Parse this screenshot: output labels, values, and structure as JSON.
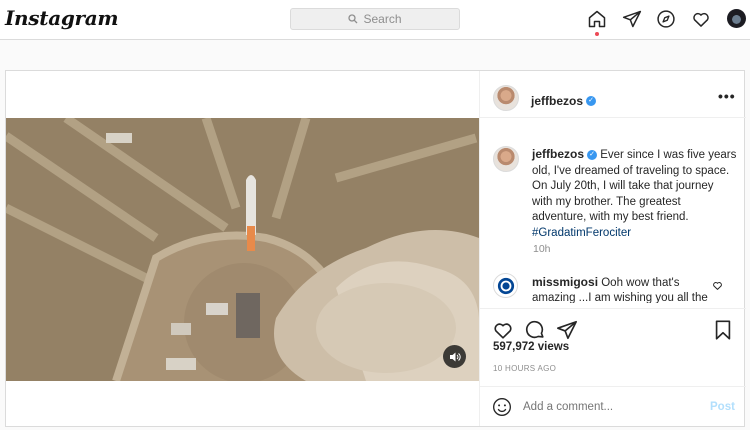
{
  "brand": {
    "logo": "Instagram"
  },
  "search": {
    "placeholder": "Search"
  },
  "nav": {
    "items": [
      "home-icon",
      "direct-icon",
      "explore-icon",
      "activity-icon",
      "profile-avatar"
    ]
  },
  "post": {
    "username": "jeffbezos",
    "caption": "Ever since I was five years old, I've dreamed of traveling to space. On July 20th, I will take that journey with my brother. The greatest adventure, with my best friend.",
    "hashtag": "#GradatimFerociter",
    "age": "10h",
    "views": "597,972 views",
    "posted": "10 HOURS AGO"
  },
  "comment": {
    "username": "missmigosi",
    "text": "Ooh wow that's amazing ...I am wishing you all the"
  },
  "add_comment": {
    "placeholder": "Add a comment...",
    "post_label": "Post"
  },
  "colors": {
    "verified": "#3897f0",
    "link": "#00376b",
    "muted": "#8e8e8e",
    "post_disabled": "#b2dffc"
  }
}
